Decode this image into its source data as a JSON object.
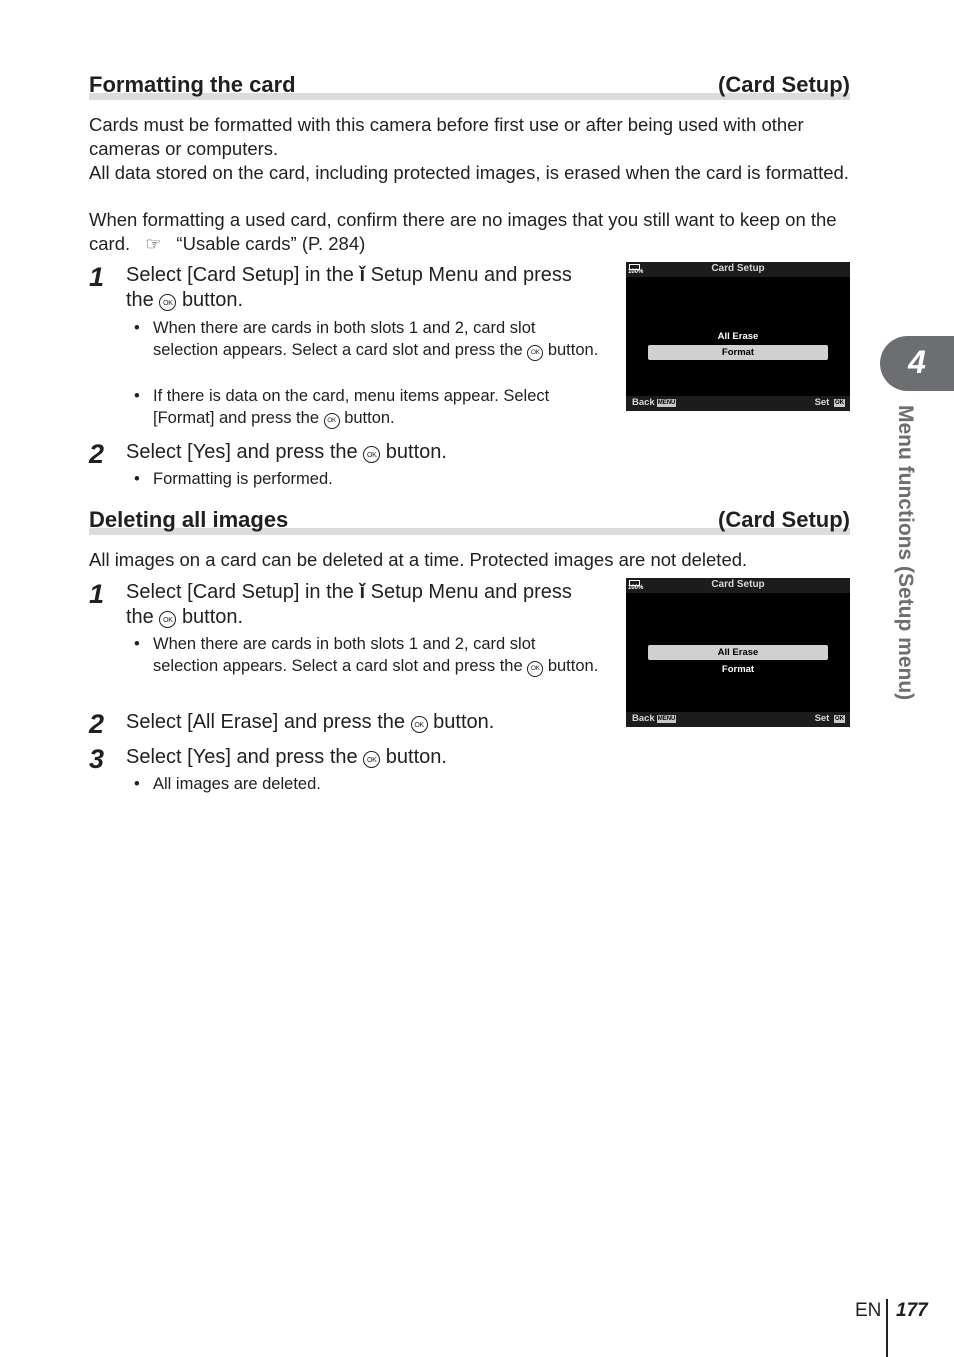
{
  "sections": [
    {
      "title": "Formatting the card",
      "tag": "(Card Setup)",
      "intro": [
        "Cards must be formatted with this camera before first use or after being used with other cameras or computers.",
        "All data stored on the card, including protected images, is erased when the card is formatted.",
        "When formatting a used card, confirm there are no images that you still want to keep on the card."
      ],
      "ref_text": "“Usable cards” (P. 284)",
      "steps": [
        {
          "num": "1",
          "text_a": "Select [Card Setup] in the",
          "text_b": "Setup Menu and press",
          "text_c": "the",
          "text_d": "button.",
          "bullets": [
            {
              "a": "When there are cards in both slots 1 and 2, card slot selection appears. Select a card slot and press the",
              "b": "button."
            },
            {
              "a": "If there is data on the card, menu items appear. Select [Format] and press the",
              "b": "button."
            }
          ]
        },
        {
          "num": "2",
          "text_a": "Select [Yes] and press the",
          "text_d": "button.",
          "bullets": [
            {
              "a": "Formatting is performed."
            }
          ]
        }
      ],
      "screen": {
        "battery": "100%",
        "title": "Card Setup",
        "items": [
          "All Erase",
          "Format"
        ],
        "selected": "Format",
        "back": "Back",
        "menu_key": "MENU",
        "set": "Set",
        "ok_key": "OK"
      }
    },
    {
      "title": "Deleting all images",
      "tag": "(Card Setup)",
      "intro": [
        "All images on a card can be deleted at a time. Protected images are not deleted."
      ],
      "steps": [
        {
          "num": "1",
          "text_a": "Select [Card Setup] in the",
          "text_b": "Setup Menu and press",
          "text_c": "the",
          "text_d": "button.",
          "bullets": [
            {
              "a": "When there are cards in both slots 1 and 2, card slot selection appears. Select a card slot and press the",
              "b": "button."
            }
          ]
        },
        {
          "num": "2",
          "text_a": "Select [All Erase] and press the",
          "text_d": "button."
        },
        {
          "num": "3",
          "text_a": "Select [Yes] and press the",
          "text_d": "button.",
          "bullets": [
            {
              "a": "All images are deleted."
            }
          ]
        }
      ],
      "screen": {
        "battery": "100%",
        "title": "Card Setup",
        "items": [
          "All Erase",
          "Format"
        ],
        "selected": "All Erase",
        "back": "Back",
        "menu_key": "MENU",
        "set": "Set",
        "ok_key": "OK"
      }
    }
  ],
  "icons": {
    "ok": "OK",
    "bullet": "•",
    "ref": "☞",
    "wrench": "ǐ"
  },
  "side": {
    "chapter_number": "4",
    "chapter_title": "Menu functions (Setup menu)"
  },
  "footer": {
    "lang": "EN",
    "page": "177"
  }
}
